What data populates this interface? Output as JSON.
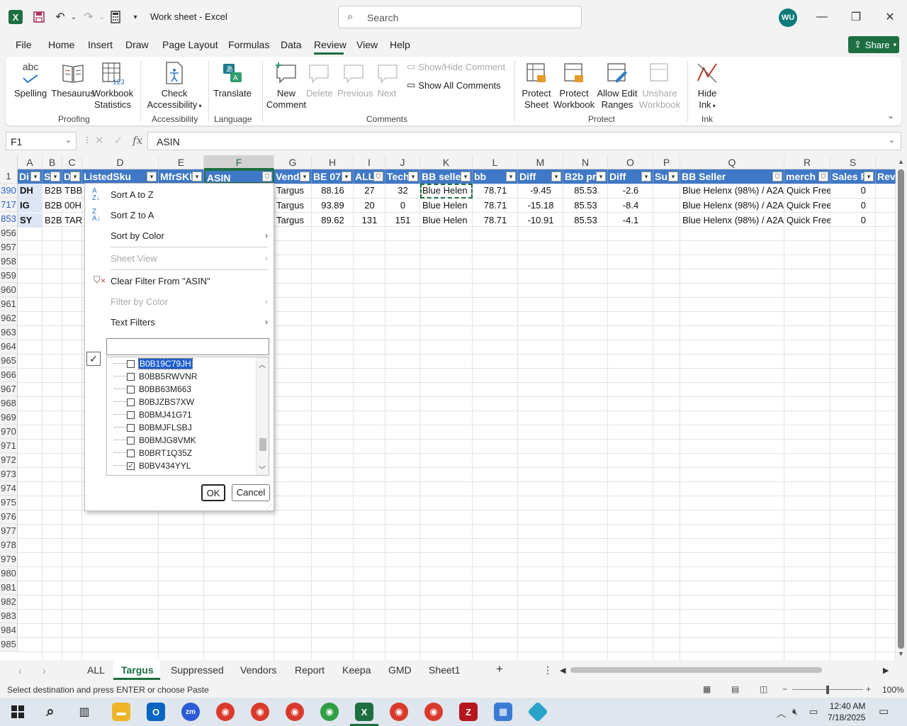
{
  "app": {
    "doc_title": "Work sheet  -  Excel",
    "search_placeholder": "Search",
    "user_initials": "WU"
  },
  "menu": {
    "items": [
      "File",
      "Home",
      "Insert",
      "Draw",
      "Page Layout",
      "Formulas",
      "Data",
      "Review",
      "View",
      "Help"
    ],
    "active": "Review",
    "share_label": "Share"
  },
  "ribbon": {
    "proofing": {
      "spelling": "Spelling",
      "thesaurus": "Thesaurus",
      "workbook_stats_1": "Workbook",
      "workbook_stats_2": "Statistics",
      "label": "Proofing"
    },
    "accessibility": {
      "check_1": "Check",
      "check_2": "Accessibility",
      "label": "Accessibility"
    },
    "language": {
      "translate": "Translate",
      "label": "Language"
    },
    "comments": {
      "new_1": "New",
      "new_2": "Comment",
      "delete": "Delete",
      "previous": "Previous",
      "next": "Next",
      "show_hide": "Show/Hide Comment",
      "show_all": "Show All Comments",
      "label": "Comments"
    },
    "protect": {
      "sheet_1": "Protect",
      "sheet_2": "Sheet",
      "workbook_1": "Protect",
      "workbook_2": "Workbook",
      "allow_1": "Allow Edit",
      "allow_2": "Ranges",
      "unshare_1": "Unshare",
      "unshare_2": "Workbook",
      "label": "Protect"
    },
    "ink": {
      "hide_1": "Hide",
      "hide_2": "Ink",
      "label": "Ink"
    },
    "abc_icon_text": "abc"
  },
  "formula_bar": {
    "name_box": "F1",
    "fx": "fx",
    "content": "ASIN"
  },
  "grid": {
    "columns": [
      "A",
      "B",
      "C",
      "D",
      "E",
      "F",
      "G",
      "H",
      "I",
      "J",
      "K",
      "L",
      "M",
      "N",
      "O",
      "P",
      "Q",
      "R",
      "S"
    ],
    "selected_column": "F",
    "row_numbers": [
      "1",
      "390",
      "717",
      "853",
      "956",
      "957",
      "958",
      "959",
      "960",
      "961",
      "962",
      "963",
      "964",
      "965",
      "966",
      "967",
      "968",
      "969",
      "970",
      "971",
      "972",
      "973",
      "974",
      "975",
      "976",
      "977",
      "978",
      "979",
      "980",
      "981",
      "982",
      "983",
      "984",
      "985"
    ],
    "headers": [
      "Di",
      "S",
      "D",
      "ListedSku",
      "MfrSKU",
      "ASIN",
      "Vend",
      "BE 07",
      "ALL",
      "Tech",
      "BB selle",
      "bb",
      "Diff",
      "B2b pr",
      "Diff",
      "Su",
      "BB Seller",
      "merch",
      "Sales R",
      "Rev"
    ],
    "rows": [
      [
        "DH",
        "B2B",
        "TBB",
        "",
        "",
        "",
        "Targus",
        "88.16",
        "27",
        "32",
        "Blue Helen",
        "78.71",
        "-9.45",
        "85.53",
        "-2.6",
        "",
        "Blue Helenx (98%) / A2A",
        "Quick Free",
        "0"
      ],
      [
        "IG",
        "B2B",
        "00H",
        "",
        "",
        "",
        "Targus",
        "93.89",
        "20",
        "0",
        "Blue Helen",
        "78.71",
        "-15.18",
        "85.53",
        "-8.4",
        "",
        "Blue Helenx (98%) / A2A",
        "Quick Free",
        "0"
      ],
      [
        "SY",
        "B2B",
        "TAR",
        "",
        "",
        "",
        "Targus",
        "89.62",
        "131",
        "151",
        "Blue Helen",
        "78.71",
        "-10.91",
        "85.53",
        "-4.1",
        "",
        "Blue Helenx (98%) / A2A",
        "Quick Free",
        "0"
      ]
    ]
  },
  "filter_menu": {
    "sort_az": "Sort A to Z",
    "sort_za": "Sort Z to A",
    "sort_color": "Sort by Color",
    "sheet_view": "Sheet View",
    "clear_filter": "Clear Filter From \"ASIN\"",
    "filter_color": "Filter by Color",
    "text_filters": "Text Filters",
    "search_value": "",
    "items": [
      {
        "label": "B0B19C79JH",
        "checked": false,
        "highlight": true
      },
      {
        "label": "B0BB5RWVNR",
        "checked": false
      },
      {
        "label": "B0BB63M663",
        "checked": false
      },
      {
        "label": "B0BJZBS7XW",
        "checked": false
      },
      {
        "label": "B0BMJ41G71",
        "checked": false
      },
      {
        "label": "B0BMJFLSBJ",
        "checked": false
      },
      {
        "label": "B0BMJG8VMK",
        "checked": false
      },
      {
        "label": "B0BRT1Q35Z",
        "checked": false
      },
      {
        "label": "B0BV434YYL",
        "checked": true
      }
    ],
    "ok": "OK",
    "cancel": "Cancel"
  },
  "sheets": {
    "tabs": [
      "ALL",
      "Targus",
      "Suppressed",
      "Vendors",
      "Report",
      "Keepa",
      "GMD",
      "Sheet1"
    ],
    "active": "Targus"
  },
  "status": {
    "text": "Select destination and press ENTER or choose Paste",
    "zoom": "100%"
  },
  "taskbar": {
    "time": "12:40 AM",
    "date": "7/18/2025"
  },
  "colors": {
    "excel_green": "#1d6f42",
    "header_blue": "#3f78c6"
  }
}
